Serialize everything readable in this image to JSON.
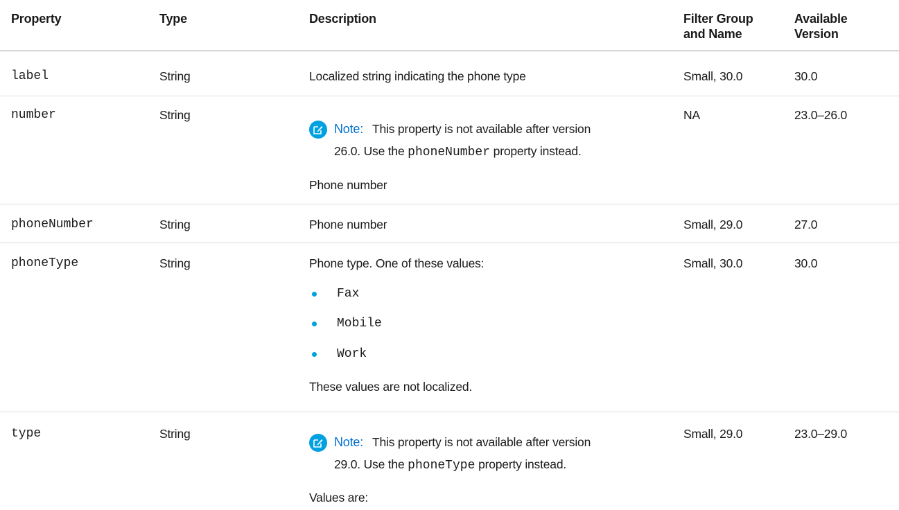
{
  "headers": {
    "property": "Property",
    "type": "Type",
    "description": "Description",
    "filter_line1": "Filter Group",
    "filter_line2": "and Name",
    "version_line1": "Available",
    "version_line2": "Version"
  },
  "rows": [
    {
      "property": "label",
      "type": "String",
      "description": "Localized string indicating the phone type",
      "filter": "Small, 30.0",
      "version": "30.0"
    },
    {
      "property": "number",
      "type": "String",
      "note_label": "Note:",
      "note_line1": "This property is not available after version",
      "note_line2_pre": "26.0. Use the",
      "note_code": "phoneNumber",
      "note_line2_post": "property instead.",
      "description": "Phone number",
      "filter": "NA",
      "version": "23.0–26.0"
    },
    {
      "property": "phoneNumber",
      "type": "String",
      "description": "Phone number",
      "filter": "Small, 29.0",
      "version": "27.0"
    },
    {
      "property": "phoneType",
      "type": "String",
      "description": "Phone type. One of these values:",
      "values": [
        "Fax",
        "Mobile",
        "Work"
      ],
      "footer": "These values are not localized.",
      "filter": "Small, 30.0",
      "version": "30.0"
    },
    {
      "property": "type",
      "type": "String",
      "note_label": "Note:",
      "note_line1": "This property is not available after version",
      "note_line2_pre": "29.0. Use the",
      "note_code": "phoneType",
      "note_line2_post": "property instead.",
      "description": "Values are:",
      "filter": "Small, 29.0",
      "version": "23.0–29.0"
    }
  ]
}
